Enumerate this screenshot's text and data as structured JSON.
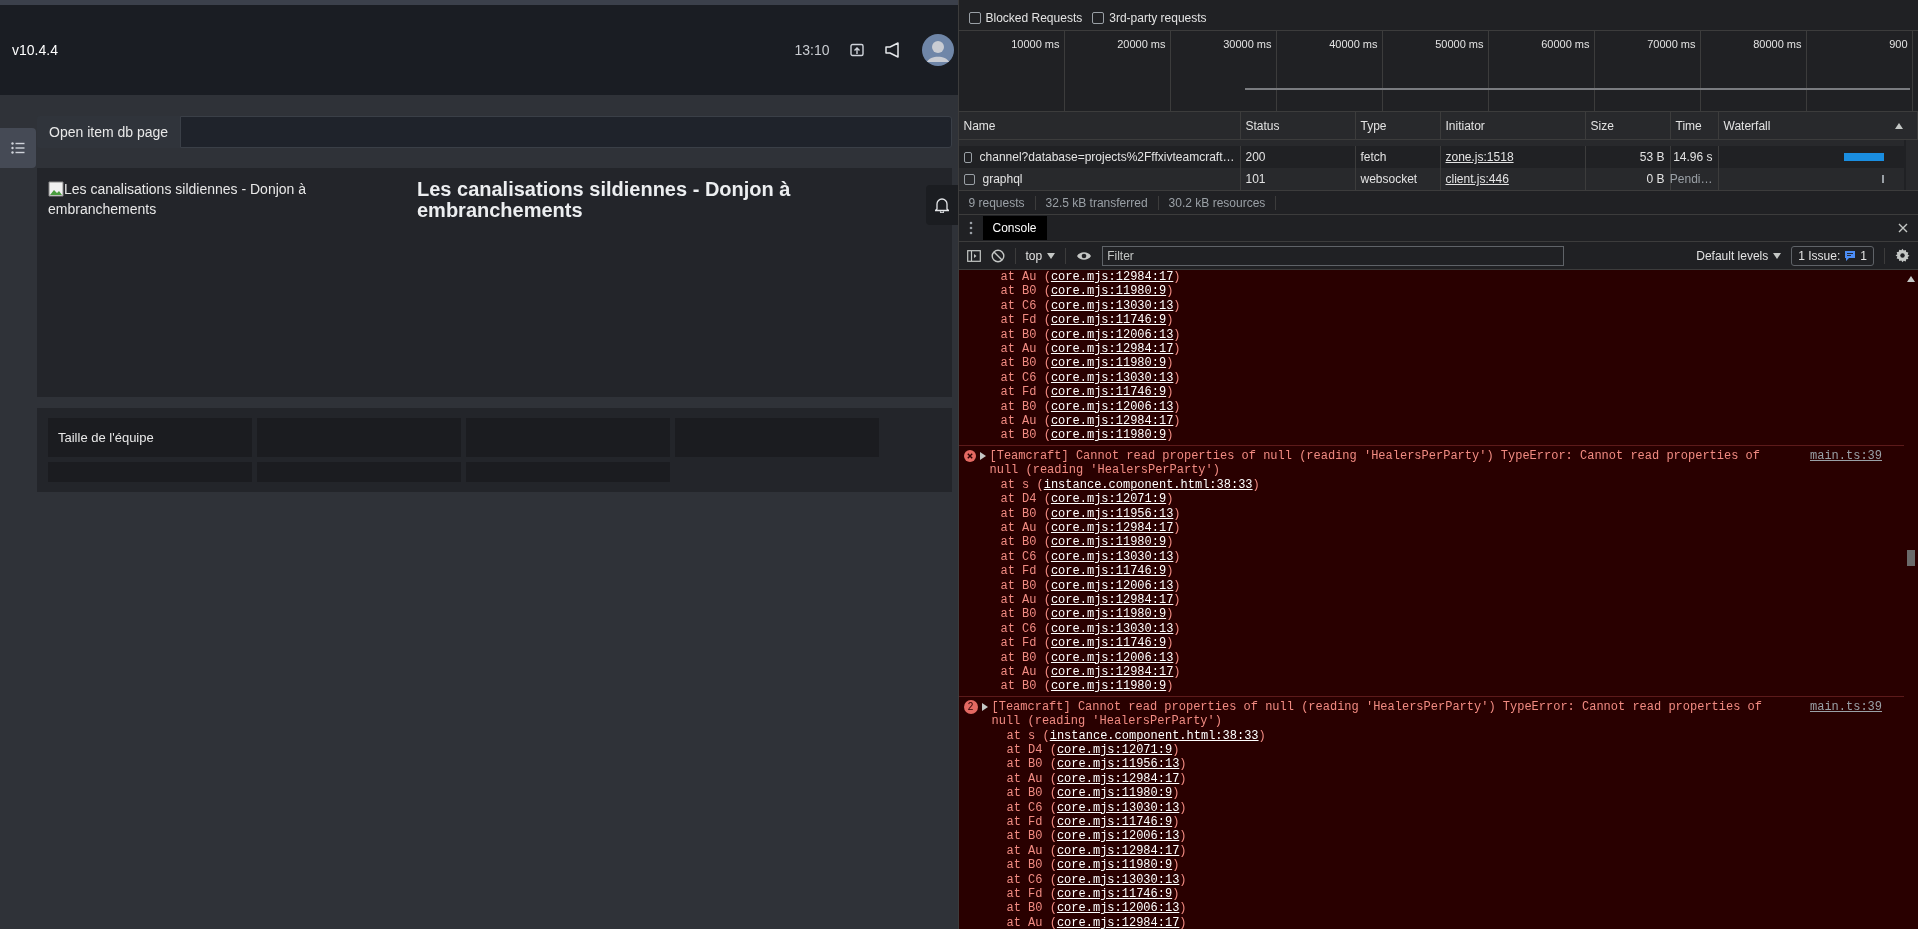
{
  "app": {
    "version": "v10.4.4",
    "time": "13:10",
    "item_db": {
      "label": "Open item db page"
    },
    "instance": {
      "image_alt": "Les canalisations sildiennes - Donjon à embranchements",
      "title": "Les canalisations sildiennes - Donjon à embranchements"
    },
    "stats": {
      "rows": [
        [
          "Taille de l'équipe",
          "",
          "",
          ""
        ],
        [
          "",
          "",
          ""
        ]
      ]
    }
  },
  "devtools": {
    "network": {
      "filters": [
        {
          "label": "Blocked Requests",
          "checked": false
        },
        {
          "label": "3rd-party requests",
          "checked": false
        }
      ],
      "ticks": [
        "10000 ms",
        "20000 ms",
        "30000 ms",
        "40000 ms",
        "50000 ms",
        "60000 ms",
        "70000 ms",
        "80000 ms",
        "900"
      ],
      "columns": [
        "Name",
        "Status",
        "Type",
        "Initiator",
        "Size",
        "Time",
        "Waterfall"
      ],
      "rows": [
        {
          "checked": false,
          "name": "channel?database=projects%2Fffxivteamcraft…",
          "status": "200",
          "type": "fetch",
          "initiator": "zone.js:1518",
          "size": "53 B",
          "time": "14.96 s",
          "pending": false
        },
        {
          "checked": false,
          "name": "graphql",
          "status": "101",
          "type": "websocket",
          "initiator": "client.js:446",
          "size": "0 B",
          "time": "Pendi…",
          "pending": true
        }
      ],
      "summary": [
        "9 requests",
        "32.5 kB transferred",
        "30.2 kB resources"
      ]
    },
    "drawer_tab": "Console",
    "toolbar": {
      "context": "top",
      "filter_placeholder": "Filter",
      "levels": "Default levels",
      "issues_label": "1 Issue:",
      "issues_count": "1"
    },
    "messages": [
      {
        "kind": "tail",
        "frames": [
          {
            "prefix": "at Au (",
            "location": "core.mjs:12984:17",
            "suffix": ")"
          },
          {
            "prefix": "at B0 (",
            "location": "core.mjs:11980:9",
            "suffix": ")"
          },
          {
            "prefix": "at C6 (",
            "location": "core.mjs:13030:13",
            "suffix": ")"
          },
          {
            "prefix": "at Fd (",
            "location": "core.mjs:11746:9",
            "suffix": ")"
          },
          {
            "prefix": "at B0 (",
            "location": "core.mjs:12006:13",
            "suffix": ")"
          },
          {
            "prefix": "at Au (",
            "location": "core.mjs:12984:17",
            "suffix": ")"
          },
          {
            "prefix": "at B0 (",
            "location": "core.mjs:11980:9",
            "suffix": ")"
          },
          {
            "prefix": "at C6 (",
            "location": "core.mjs:13030:13",
            "suffix": ")"
          },
          {
            "prefix": "at Fd (",
            "location": "core.mjs:11746:9",
            "suffix": ")"
          },
          {
            "prefix": "at B0 (",
            "location": "core.mjs:12006:13",
            "suffix": ")"
          },
          {
            "prefix": "at Au (",
            "location": "core.mjs:12984:17",
            "suffix": ")"
          },
          {
            "prefix": "at B0 (",
            "location": "core.mjs:11980:9",
            "suffix": ")"
          }
        ]
      },
      {
        "kind": "error",
        "expanded": false,
        "message": "[Teamcraft] Cannot read properties of null (reading 'HealersPerParty') TypeError: Cannot read properties of null (reading 'HealersPerParty')",
        "source": "main.ts:39",
        "frames": [
          {
            "prefix": "at s (",
            "location": "instance.component.html:38:33",
            "suffix": ")"
          },
          {
            "prefix": "at D4 (",
            "location": "core.mjs:12071:9",
            "suffix": ")"
          },
          {
            "prefix": "at B0 (",
            "location": "core.mjs:11956:13",
            "suffix": ")"
          },
          {
            "prefix": "at Au (",
            "location": "core.mjs:12984:17",
            "suffix": ")"
          },
          {
            "prefix": "at B0 (",
            "location": "core.mjs:11980:9",
            "suffix": ")"
          },
          {
            "prefix": "at C6 (",
            "location": "core.mjs:13030:13",
            "suffix": ")"
          },
          {
            "prefix": "at Fd (",
            "location": "core.mjs:11746:9",
            "suffix": ")"
          },
          {
            "prefix": "at B0 (",
            "location": "core.mjs:12006:13",
            "suffix": ")"
          },
          {
            "prefix": "at Au (",
            "location": "core.mjs:12984:17",
            "suffix": ")"
          },
          {
            "prefix": "at B0 (",
            "location": "core.mjs:11980:9",
            "suffix": ")"
          },
          {
            "prefix": "at C6 (",
            "location": "core.mjs:13030:13",
            "suffix": ")"
          },
          {
            "prefix": "at Fd (",
            "location": "core.mjs:11746:9",
            "suffix": ")"
          },
          {
            "prefix": "at B0 (",
            "location": "core.mjs:12006:13",
            "suffix": ")"
          },
          {
            "prefix": "at Au (",
            "location": "core.mjs:12984:17",
            "suffix": ")"
          },
          {
            "prefix": "at B0 (",
            "location": "core.mjs:11980:9",
            "suffix": ")"
          }
        ]
      },
      {
        "kind": "error",
        "expanded": false,
        "count": "2",
        "message": "[Teamcraft] Cannot read properties of null (reading 'HealersPerParty') TypeError: Cannot read properties of null (reading 'HealersPerParty')",
        "source": "main.ts:39",
        "frames": [
          {
            "prefix": "at s (",
            "location": "instance.component.html:38:33",
            "suffix": ")"
          },
          {
            "prefix": "at D4 (",
            "location": "core.mjs:12071:9",
            "suffix": ")"
          },
          {
            "prefix": "at B0 (",
            "location": "core.mjs:11956:13",
            "suffix": ")"
          },
          {
            "prefix": "at Au (",
            "location": "core.mjs:12984:17",
            "suffix": ")"
          },
          {
            "prefix": "at B0 (",
            "location": "core.mjs:11980:9",
            "suffix": ")"
          },
          {
            "prefix": "at C6 (",
            "location": "core.mjs:13030:13",
            "suffix": ")"
          },
          {
            "prefix": "at Fd (",
            "location": "core.mjs:11746:9",
            "suffix": ")"
          },
          {
            "prefix": "at B0 (",
            "location": "core.mjs:12006:13",
            "suffix": ")"
          },
          {
            "prefix": "at Au (",
            "location": "core.mjs:12984:17",
            "suffix": ")"
          },
          {
            "prefix": "at B0 (",
            "location": "core.mjs:11980:9",
            "suffix": ")"
          },
          {
            "prefix": "at C6 (",
            "location": "core.mjs:13030:13",
            "suffix": ")"
          },
          {
            "prefix": "at Fd (",
            "location": "core.mjs:11746:9",
            "suffix": ")"
          },
          {
            "prefix": "at B0 (",
            "location": "core.mjs:12006:13",
            "suffix": ")"
          },
          {
            "prefix": "at Au (",
            "location": "core.mjs:12984:17",
            "suffix": ")"
          }
        ]
      }
    ]
  }
}
